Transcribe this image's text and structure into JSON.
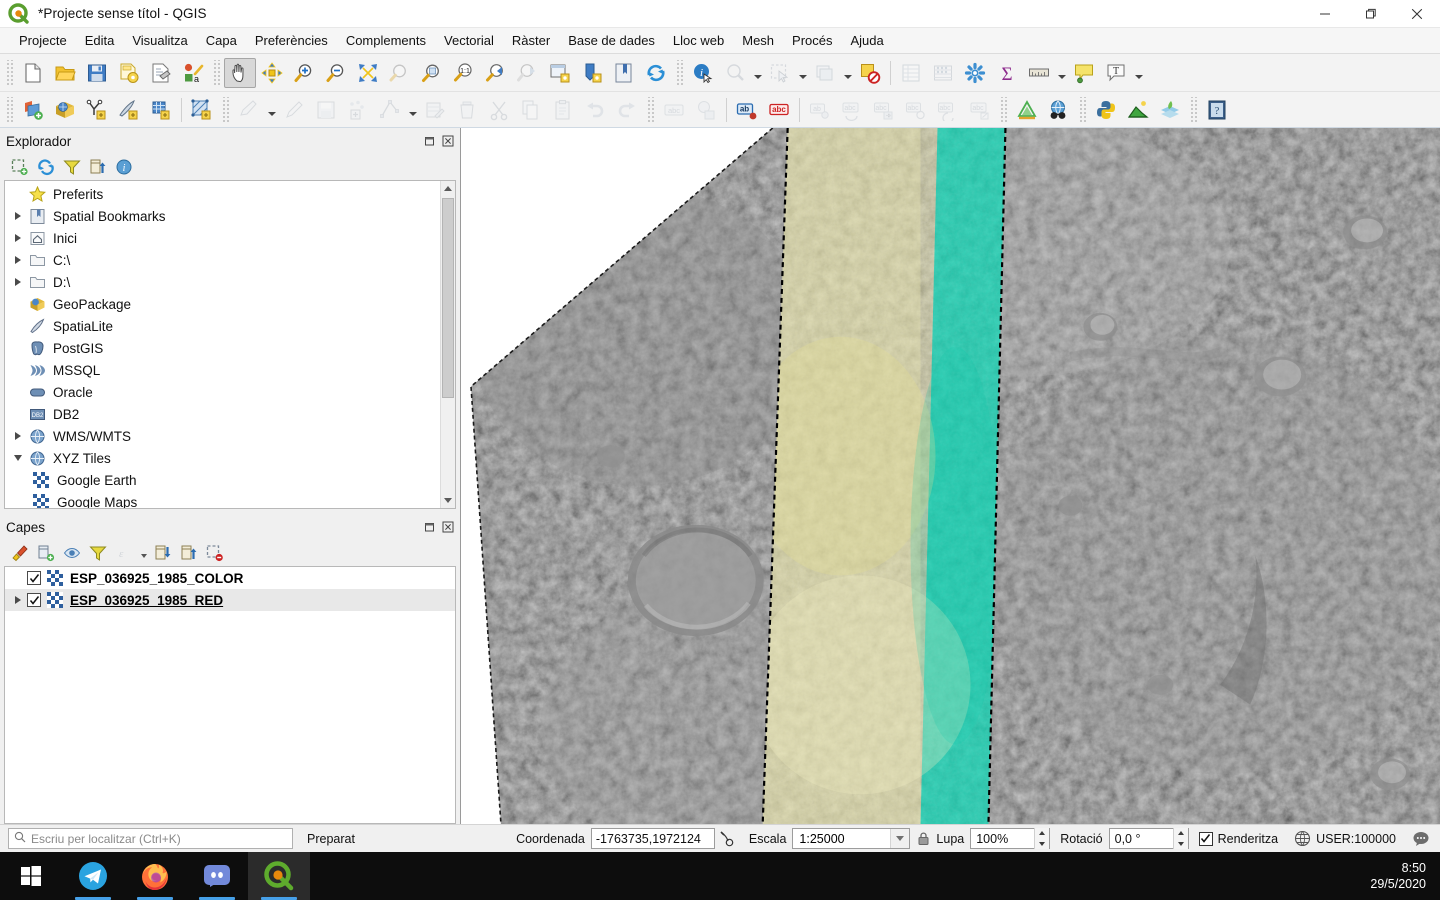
{
  "window": {
    "title": "*Projecte sense títol - QGIS",
    "app_icon": "qgis-logo-icon",
    "minimize": "—",
    "maximize": "❐",
    "close": "✕"
  },
  "menubar": {
    "items": [
      {
        "label": "Projecte"
      },
      {
        "label": "Edita"
      },
      {
        "label": "Visualitza"
      },
      {
        "label": "Capa"
      },
      {
        "label": "Preferències"
      },
      {
        "label": "Complements"
      },
      {
        "label": "Vectorial"
      },
      {
        "label": "Ràster"
      },
      {
        "label": "Base de dades"
      },
      {
        "label": "Lloc web"
      },
      {
        "label": "Mesh"
      },
      {
        "label": "Procés"
      },
      {
        "label": "Ajuda"
      }
    ]
  },
  "toolbar_main": {
    "buttons": [
      {
        "name": "new-project-icon"
      },
      {
        "name": "open-project-icon"
      },
      {
        "name": "save-project-icon"
      },
      {
        "name": "save-project-as-icon"
      },
      {
        "name": "new-print-layout-icon"
      },
      {
        "name": "style-manager-icon"
      },
      {
        "name": "pan-map-icon",
        "state": "pressed"
      },
      {
        "name": "pan-to-selection-icon"
      },
      {
        "name": "zoom-in-icon"
      },
      {
        "name": "zoom-out-icon"
      },
      {
        "name": "zoom-full-icon"
      },
      {
        "name": "zoom-to-selection-icon",
        "state": "disabled"
      },
      {
        "name": "zoom-to-layer-icon"
      },
      {
        "name": "zoom-native-icon"
      },
      {
        "name": "zoom-last-icon"
      },
      {
        "name": "zoom-next-icon",
        "state": "disabled"
      },
      {
        "name": "new-map-view-icon"
      },
      {
        "name": "new-3d-map-view-icon"
      },
      {
        "name": "new-bookmark-icon"
      },
      {
        "name": "refresh-icon"
      },
      {
        "name": "identify-features-icon"
      },
      {
        "name": "measure-line-icon",
        "state": "disabled"
      },
      {
        "name": "select-features-icon",
        "state": "disabled"
      },
      {
        "name": "select-by-value-icon",
        "state": "disabled"
      },
      {
        "name": "deselect-features-icon"
      },
      {
        "name": "open-attribute-table-icon",
        "state": "disabled"
      },
      {
        "name": "open-field-calculator-icon",
        "state": "disabled"
      },
      {
        "name": "processing-toolbox-icon"
      },
      {
        "name": "statistical-summary-icon"
      },
      {
        "name": "measure-icon"
      },
      {
        "name": "map-tips-icon"
      },
      {
        "name": "text-annotation-icon"
      }
    ]
  },
  "toolbar_second": {
    "buttons": [
      {
        "name": "add-vector-layer-icon"
      },
      {
        "name": "add-raster-layer-icon"
      },
      {
        "name": "add-delimited-text-layer-icon"
      },
      {
        "name": "add-spatialite-layer-icon"
      },
      {
        "name": "add-postgis-layer-icon"
      },
      {
        "name": "add-mesh-layer-icon"
      },
      {
        "name": "current-edits-icon",
        "state": "disabled"
      },
      {
        "name": "toggle-editing-icon",
        "state": "disabled"
      },
      {
        "name": "save-layer-edits-icon",
        "state": "disabled"
      },
      {
        "name": "add-feature-icon",
        "state": "disabled"
      },
      {
        "name": "vertex-tool-icon",
        "state": "disabled"
      },
      {
        "name": "modify-attributes-icon",
        "state": "disabled"
      },
      {
        "name": "delete-selected-icon",
        "state": "disabled"
      },
      {
        "name": "cut-features-icon",
        "state": "disabled"
      },
      {
        "name": "copy-features-icon",
        "state": "disabled"
      },
      {
        "name": "paste-features-icon",
        "state": "disabled"
      },
      {
        "name": "undo-icon",
        "state": "disabled"
      },
      {
        "name": "redo-icon",
        "state": "disabled"
      },
      {
        "name": "label-toolbar-icon",
        "state": "disabled"
      },
      {
        "name": "pin-labels-icon",
        "state": "disabled"
      },
      {
        "name": "highlight-pinned-labels-icon"
      },
      {
        "name": "show-hide-labels-icon"
      },
      {
        "name": "move-label-icon",
        "state": "disabled"
      },
      {
        "name": "rotate-label-icon",
        "state": "disabled"
      },
      {
        "name": "change-label-icon",
        "state": "disabled"
      },
      {
        "name": "label-properties-icon",
        "state": "disabled"
      },
      {
        "name": "label-callout-icon",
        "state": "disabled"
      },
      {
        "name": "label-settings-icon",
        "state": "disabled"
      },
      {
        "name": "georeferencer-icon"
      },
      {
        "name": "metasearch-icon"
      },
      {
        "name": "python-console-icon"
      },
      {
        "name": "terrain-profile-icon"
      },
      {
        "name": "qgis2web-icon"
      },
      {
        "name": "help-icon"
      }
    ]
  },
  "browser_panel": {
    "title": "Explorador",
    "toolbar": [
      {
        "name": "add-selected-layers-icon"
      },
      {
        "name": "refresh-icon"
      },
      {
        "name": "filter-browser-icon"
      },
      {
        "name": "collapse-all-icon"
      },
      {
        "name": "properties-icon"
      }
    ],
    "tree": [
      {
        "label": "Preferits",
        "icon": "favourites-star-icon",
        "expandable": false,
        "indent": 0
      },
      {
        "label": "Spatial Bookmarks",
        "icon": "bookmark-icon",
        "expandable": true,
        "expanded": false,
        "indent": 0
      },
      {
        "label": "Inici",
        "icon": "home-icon",
        "expandable": true,
        "expanded": false,
        "indent": 0
      },
      {
        "label": "C:\\",
        "icon": "folder-icon",
        "expandable": true,
        "expanded": false,
        "indent": 0
      },
      {
        "label": "D:\\",
        "icon": "folder-icon",
        "expandable": true,
        "expanded": false,
        "indent": 0
      },
      {
        "label": "GeoPackage",
        "icon": "geopackage-icon",
        "expandable": false,
        "indent": 0
      },
      {
        "label": "SpatiaLite",
        "icon": "spatialite-icon",
        "expandable": false,
        "indent": 0
      },
      {
        "label": "PostGIS",
        "icon": "postgis-icon",
        "expandable": false,
        "indent": 0
      },
      {
        "label": "MSSQL",
        "icon": "mssql-icon",
        "expandable": false,
        "indent": 0
      },
      {
        "label": "Oracle",
        "icon": "oracle-icon",
        "expandable": false,
        "indent": 0
      },
      {
        "label": "DB2",
        "icon": "db2-icon",
        "expandable": false,
        "indent": 0
      },
      {
        "label": "WMS/WMTS",
        "icon": "globe-icon",
        "expandable": true,
        "expanded": false,
        "indent": 0
      },
      {
        "label": "XYZ Tiles",
        "icon": "globe-icon",
        "expandable": true,
        "expanded": true,
        "indent": 0
      },
      {
        "label": "Google Earth",
        "icon": "raster-tile-icon",
        "expandable": false,
        "indent": 1
      },
      {
        "label": "Google Maps",
        "icon": "raster-tile-icon",
        "expandable": false,
        "indent": 1
      }
    ]
  },
  "layers_panel": {
    "title": "Capes",
    "toolbar": [
      {
        "name": "open-layer-styling-panel-icon"
      },
      {
        "name": "add-group-icon"
      },
      {
        "name": "manage-map-themes-icon"
      },
      {
        "name": "filter-legend-icon"
      },
      {
        "name": "filter-legend-expression-icon",
        "state": "disabled"
      },
      {
        "name": "expand-all-icon"
      },
      {
        "name": "collapse-all-icon"
      },
      {
        "name": "remove-layer-icon"
      }
    ],
    "layers": [
      {
        "name": "ESP_036925_1985_COLOR",
        "checked": true,
        "expandable": false,
        "selected": false,
        "underline": false
      },
      {
        "name": "ESP_036925_1985_RED",
        "checked": true,
        "expandable": true,
        "selected": true,
        "underline": true
      }
    ]
  },
  "map_canvas": {
    "name": "map-canvas",
    "background": "#ffffff",
    "raster_gray": "#a3a3a3",
    "overlay_yellow": "#ece8b0",
    "overlay_cyan": "#10d9b8",
    "outline": "#000000"
  },
  "statusbar": {
    "locator_placeholder": "Escriu per localitzar (Ctrl+K)",
    "status_message": "Preparat",
    "coordinate_label": "Coordenada",
    "coordinate_value": "-1763735,1972124",
    "toggle_extents_icon": "toggle-extents-icon",
    "scale_label": "Escala",
    "scale_value": "1:25000",
    "lock_icon": "lock-scale-icon",
    "magnifier_label": "Lupa",
    "magnifier_value": "100%",
    "rotation_label": "Rotació",
    "rotation_value": "0,0 °",
    "render_label": "Renderitza",
    "render_checked": true,
    "crs_icon": "crs-globe-icon",
    "crs_value": "USER:100000",
    "messages_icon": "messages-log-icon"
  },
  "taskbar": {
    "items": [
      {
        "name": "start-button-icon",
        "label": "Start"
      },
      {
        "name": "telegram-icon",
        "label": "Telegram",
        "running": true
      },
      {
        "name": "firefox-icon",
        "label": "Firefox",
        "running": true
      },
      {
        "name": "discord-icon",
        "label": "Discord",
        "running": true
      },
      {
        "name": "qgis-taskbar-icon",
        "label": "QGIS",
        "running": true,
        "active": true
      }
    ],
    "clock": {
      "time": "8:50",
      "date": "29/5/2020"
    }
  }
}
